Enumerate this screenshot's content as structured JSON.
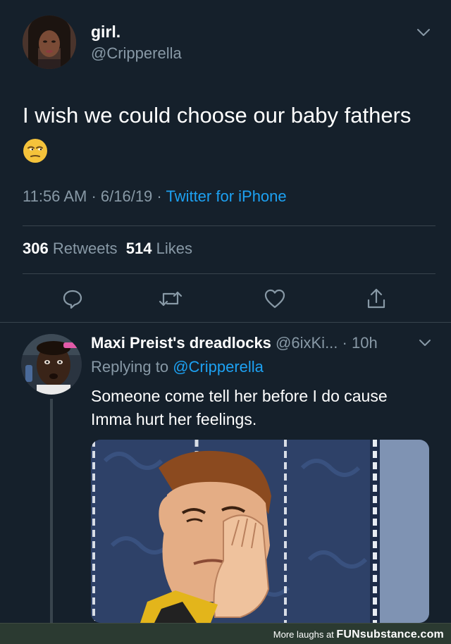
{
  "tweet": {
    "author_name": "girl.",
    "author_handle": "@Cripperella",
    "text": "I wish we could choose our baby fathers",
    "emoji_icon": "unamused-face-emoji",
    "time": "11:56 AM",
    "date": "6/16/19",
    "meta_sep": " · ",
    "source": "Twitter for iPhone",
    "retweets_count": "306",
    "retweets_label": "Retweets",
    "likes_count": "514",
    "likes_label": "Likes",
    "actions": [
      "reply-icon",
      "retweet-icon",
      "like-icon",
      "share-icon"
    ]
  },
  "reply": {
    "author_name": "Maxi Preist's dreadlocks",
    "author_handle": "@6ixKi...",
    "time": "· 10h",
    "replying_prefix": "Replying to",
    "replying_to": "@Cripperella",
    "text": "Someone come tell her before I do cause Imma hurt her feelings."
  },
  "footer": {
    "prefix": "More laughs at",
    "brand": "FUNsubstance.com"
  },
  "colors": {
    "background": "#15202b",
    "accent": "#1da1f2",
    "secondary_text": "#8899a6",
    "divider": "#38444d"
  }
}
